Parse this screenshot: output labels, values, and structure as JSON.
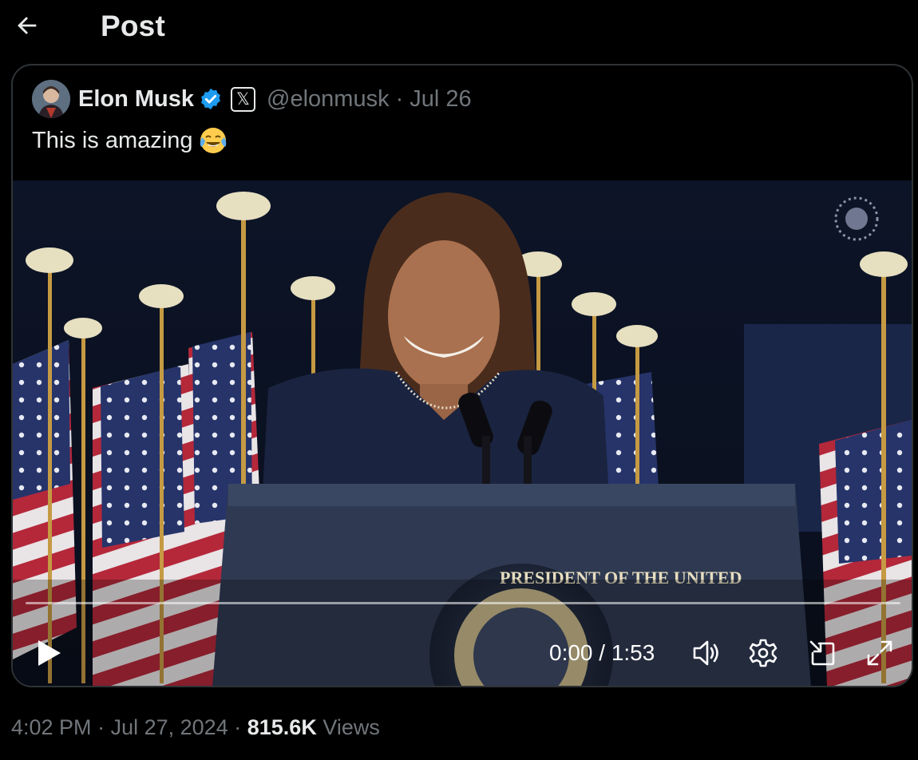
{
  "header": {
    "title": "Post",
    "back_icon": "arrow-left-icon"
  },
  "quoted_post": {
    "author_name": "Elon Musk",
    "verified_icon": "verified-badge-icon",
    "affiliate_label": "𝕏",
    "handle": "@elonmusk",
    "separator": "·",
    "date": "Jul 26",
    "text": "This is amazing",
    "emoji_icon": "tears-of-joy-emoji-icon",
    "video": {
      "time_current": "0:00",
      "time_total": "1:53",
      "time_display": "0:00 / 1:53",
      "progress": 0,
      "controls": [
        "play-icon",
        "volume-icon",
        "settings-icon",
        "pip-icon",
        "fullscreen-icon"
      ],
      "scene_text": "PRESIDENT OF THE UNITED"
    }
  },
  "meta": {
    "time": "4:02 PM",
    "date": "Jul 27, 2024",
    "separator": "·",
    "views_count": "815.6K",
    "views_label": "Views"
  },
  "colors": {
    "background": "#000000",
    "text_primary": "#e7e9ea",
    "text_secondary": "#71767b",
    "border": "#2f3336",
    "verified_blue": "#1d9bf0"
  }
}
